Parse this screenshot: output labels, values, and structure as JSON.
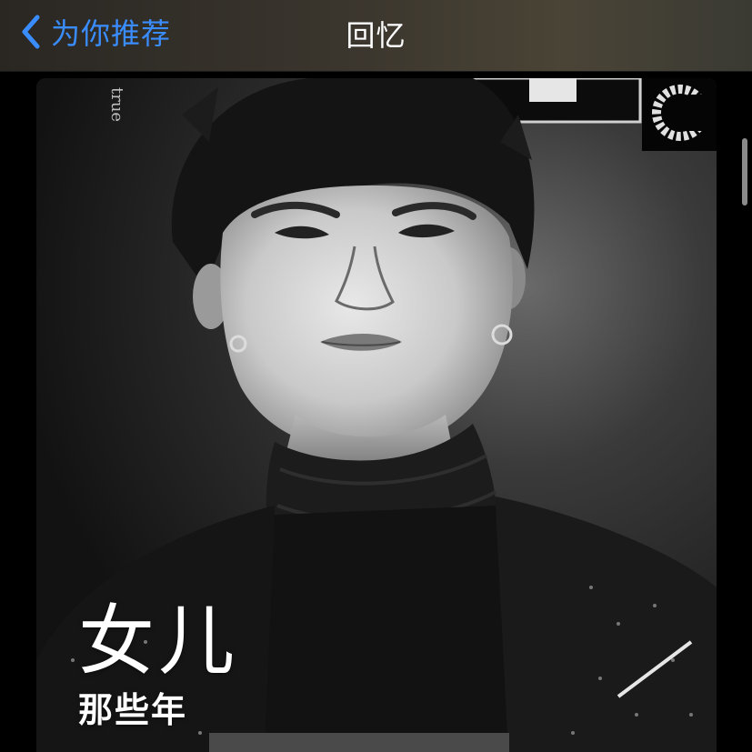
{
  "navbar": {
    "back_label": "为你推荐",
    "back_icon": "chevron-left-icon",
    "title": "回忆"
  },
  "memory": {
    "title": "女儿",
    "subtitle": "那些年",
    "poster_text": "true"
  },
  "colors": {
    "accent": "#3a8dff",
    "title_text": "#ffffff"
  }
}
